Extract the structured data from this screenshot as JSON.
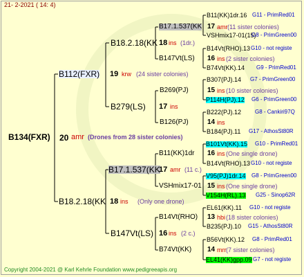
{
  "date": "21-  2-2021  ( 14:  4)",
  "copyright": "Copyright 2004-2021 @ Karl Kehrle Foundation     www.pedigreeapis.org",
  "root": {
    "name": "B134(FXR)",
    "num": "20",
    "ins": "amr",
    "note": "(Drones from 28 sister colonies)"
  },
  "gen2": {
    "top": {
      "name": "B112(FXR)",
      "num": "19",
      "ins": "krw",
      "note": "(24 sister colonies)"
    },
    "bottom": {
      "name": "B18.2.18(KK",
      "num": "18",
      "ins": "ins",
      "note": "(Only one drone)"
    }
  },
  "gen3": [
    {
      "name": "B18.2.18(KK",
      "num": "18",
      "ins": "ins",
      "note": "(1dr.)"
    },
    {
      "name": "B279(LS)",
      "num": "17",
      "ins": "ins",
      "note": ""
    },
    {
      "name": "B17.1.537(KK",
      "num": "17",
      "ins": "amr",
      "note": "(11 c.)"
    },
    {
      "name": "B147Vt(LS)",
      "num": "16",
      "ins": "ins",
      "note": "(2 c.)"
    }
  ],
  "gen4": [
    {
      "name": "B17.1.537(KK",
      "num": "17",
      "ins": "amr",
      "note": "(11 sister colonies)"
    },
    {
      "name": "B147Vt(LS)",
      "num": "16",
      "ins": "ins",
      "note": "(2 sister colonies)"
    },
    {
      "name": "B269(PJ)",
      "num": "15",
      "ins": "ins",
      "note": "(10 sister colonies)"
    },
    {
      "name": "B126(PJ)",
      "num": "14",
      "ins": "ins",
      "note": ""
    },
    {
      "name": "B11(KK)1dr",
      "num": "16",
      "ins": "ins",
      "note": "(One single drone)"
    },
    {
      "name": "VSHmix17-01",
      "num": "15",
      "ins": "ins",
      "note": "(One single drone)"
    },
    {
      "name": "B14Vt(RHO)",
      "num": "13",
      "ins": "hbi",
      "note": "(18 sister colonies)"
    },
    {
      "name": "B74Vt(KK)",
      "num": "14",
      "ins": "mrr",
      "note": "(7 sister colonies)"
    }
  ],
  "gen5": [
    {
      "name": "B11(KK)1dr.16",
      "group": "G11 - PrimRed01"
    },
    {
      "name": "VSHmix17-01(15)",
      "group": "G8 - PrimGreen00"
    },
    {
      "name": "B14Vt(RHO).13",
      "group": "G10 - not registe"
    },
    {
      "name": "B74Vt(KK).14",
      "group": "G9 - PrimRed01"
    },
    {
      "name": "B307(PJ).14",
      "group": "G7 - PrimGreen00"
    },
    {
      "name": "P114H(PJ).12",
      "group": "G6 - PrimGreen00"
    },
    {
      "name": "B222(PJ).12",
      "group": "G8 - Cankiri97Q"
    },
    {
      "name": "B184(PJ).11",
      "group": "G17 - AthosSt80R"
    },
    {
      "name": "B101Vt(KK).15",
      "group": "G10 - PrimRed01"
    },
    {
      "name": "B14Vt(RHO).13",
      "group": "G10 - not registe"
    },
    {
      "name": "V95(PJ)1dr.14",
      "group": "G8 - PrimGreen00"
    },
    {
      "name": "V154H(RL).13",
      "group": "G25 - Sinop62R"
    },
    {
      "name": "EL61(KK).11",
      "group": "G10 - not registe"
    },
    {
      "name": "B235(PJ).10",
      "group": "G15 - AthosSt80R"
    },
    {
      "name": "B56Vt(KK).12",
      "group": "G8 - PrimRed01"
    },
    {
      "name": "EL41(KK)gpp.09",
      "group": "G7 - not registe"
    }
  ]
}
